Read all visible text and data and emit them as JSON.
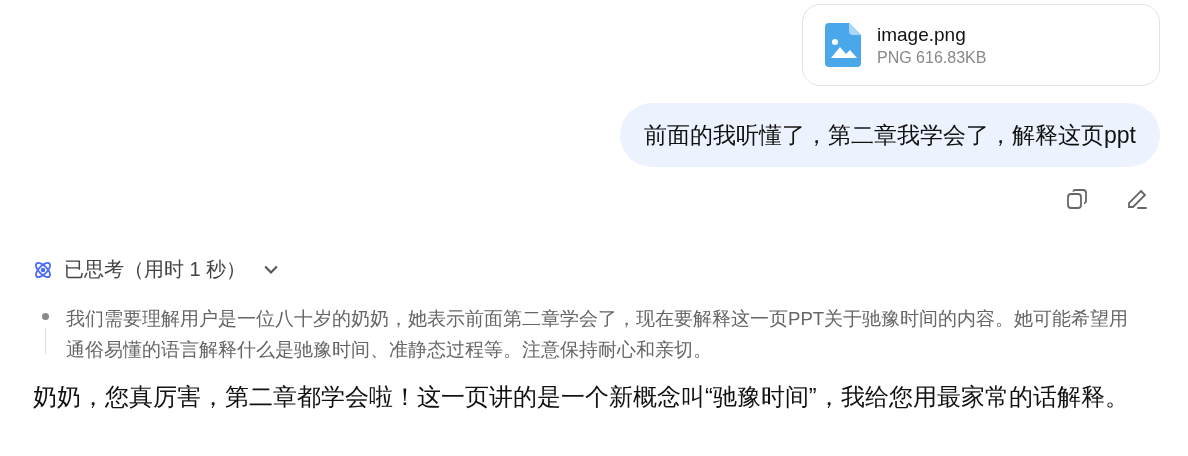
{
  "attachment": {
    "name": "image.png",
    "meta": "PNG 616.83KB"
  },
  "user_message": {
    "text": "前面的我听懂了，第二章我学会了，解释这页ppt"
  },
  "thinking": {
    "label": "已思考（用时 1 秒）",
    "expanded": true,
    "text": "我们需要理解用户是一位八十岁的奶奶，她表示前面第二章学会了，现在要解释这一页PPT关于驰豫时间的内容。她可能希望用通俗易懂的语言解释什么是驰豫时间、准静态过程等。注意保持耐心和亲切。"
  },
  "answer": {
    "text": "奶奶，您真厉害，第二章都学会啦！这一页讲的是一个新概念叫“驰豫时间”，我给您用最家常的话解释。"
  }
}
